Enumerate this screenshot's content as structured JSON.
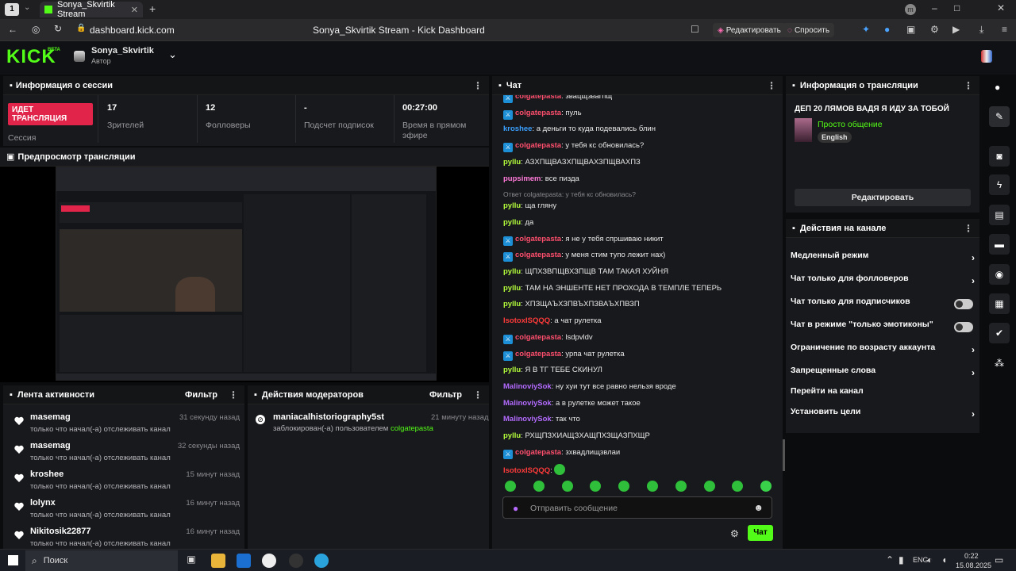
{
  "browser": {
    "tab_num": "1",
    "tab_title": "Sonya_Skvirtik Stream",
    "url": "dashboard.kick.com",
    "page_title": "Sonya_Skvirtik Stream - Kick Dashboard",
    "edit_label": "Редактировать",
    "ask_label": "Спросить",
    "avatar_letter": "m"
  },
  "header": {
    "logo": "KICK",
    "logo_sup": "BETA",
    "channel": "Sonya_Skvirtik",
    "role": "Автор"
  },
  "session": {
    "title": "Информация о сессии",
    "live_badge": "ИДЕТ ТРАНСЛЯЦИЯ",
    "live_label": "Сессия",
    "stats": [
      {
        "value": "17",
        "label": "Зрителей"
      },
      {
        "value": "12",
        "label": "Фолловеры"
      },
      {
        "value": "-",
        "label": "Подсчет подписок"
      },
      {
        "value": "00:27:00",
        "label": "Время в прямом эфире"
      }
    ]
  },
  "preview": {
    "title": "Предпросмотр трансляции"
  },
  "activity": {
    "title": "Лента активности",
    "filter": "Фильтр",
    "items": [
      {
        "name": "masemag",
        "time": "31 секунду назад",
        "desc": "только что начал(-а) отслеживать канал"
      },
      {
        "name": "masemag",
        "time": "32 секунды назад",
        "desc": "только что начал(-а) отслеживать канал"
      },
      {
        "name": "kroshee",
        "time": "15 минут назад",
        "desc": "только что начал(-а) отслеживать канал"
      },
      {
        "name": "lolynx",
        "time": "16 минут назад",
        "desc": "только что начал(-а) отслеживать канал"
      },
      {
        "name": "Nikitosik22877",
        "time": "16 минут назад",
        "desc": "только что начал(-а) отслеживать канал"
      }
    ]
  },
  "moderators": {
    "title": "Действия модераторов",
    "filter": "Фильтр",
    "item": {
      "name": "maniacalhistoriography5st",
      "time": "21 минуту назад",
      "desc": "заблокирован(-а) пользователем",
      "target": "colgatepasta"
    }
  },
  "chat": {
    "title": "Чат",
    "messages": [
      {
        "user": "colgatepasta",
        "color": "#ff4f6e",
        "badge": true,
        "text": "звацщзвагпщ"
      },
      {
        "user": "colgatepasta",
        "color": "#ff4f6e",
        "badge": true,
        "text": "пуль"
      },
      {
        "user": "kroshee",
        "color": "#3aa0ff",
        "badge": false,
        "text": "а деньги то куда подевались блин"
      },
      {
        "user": "colgatepasta",
        "color": "#ff4f6e",
        "badge": true,
        "text": "у тебя кс обновилась?"
      },
      {
        "user": "pyllu",
        "color": "#b6ff3c",
        "badge": false,
        "text": "АЗХПЩВАЗХПЩВАХЗПЩВАХПЗ"
      },
      {
        "user": "pupsimem",
        "color": "#ff7ad9",
        "badge": false,
        "text": "все пизда"
      },
      {
        "user": "pyllu",
        "color": "#b6ff3c",
        "badge": false,
        "text": "ща гляну",
        "reply": "Ответ colgatepasta: у тебя кс обновилась?"
      },
      {
        "user": "pyllu",
        "color": "#b6ff3c",
        "badge": false,
        "text": "да"
      },
      {
        "user": "colgatepasta",
        "color": "#ff4f6e",
        "badge": true,
        "text": "я не у тебя спршиваю никит"
      },
      {
        "user": "colgatepasta",
        "color": "#ff4f6e",
        "badge": true,
        "text": "у меня стим тупо лежит нах)"
      },
      {
        "user": "pyllu",
        "color": "#b6ff3c",
        "badge": false,
        "text": "ЩПХЗВПЩВХЗПЩВ ТАМ ТАКАЯ ХУЙНЯ"
      },
      {
        "user": "pyllu",
        "color": "#b6ff3c",
        "badge": false,
        "text": "ТАМ НА ЭНШЕНТЕ НЕТ ПРОХОДА В ТЕМПЛЕ ТЕПЕРЬ"
      },
      {
        "user": "pyllu",
        "color": "#b6ff3c",
        "badge": false,
        "text": "ХПЗЩАЪХЗПВЪХПЗВАЪХПВЗП"
      },
      {
        "user": "IsotoxISQQQ",
        "color": "#ff3b3b",
        "badge": false,
        "text": "а чат рулетка"
      },
      {
        "user": "colgatepasta",
        "color": "#ff4f6e",
        "badge": true,
        "text": "lsdpvldv"
      },
      {
        "user": "colgatepasta",
        "color": "#ff4f6e",
        "badge": true,
        "text": "урпа чат рулетка"
      },
      {
        "user": "pyllu",
        "color": "#b6ff3c",
        "badge": false,
        "text": "Я В ТГ ТЕБЕ СКИНУЛ"
      },
      {
        "user": "MalinoviySok",
        "color": "#b36bff",
        "badge": false,
        "text": "ну хуи тут все равно нельзя вроде"
      },
      {
        "user": "MalinoviySok",
        "color": "#b36bff",
        "badge": false,
        "text": "а в рулетке может такое"
      },
      {
        "user": "MalinoviySok",
        "color": "#b36bff",
        "badge": false,
        "text": "так что"
      },
      {
        "user": "pyllu",
        "color": "#b6ff3c",
        "badge": false,
        "text": "РХЩПЗХИАЩЗХАЩПХЗЩАЗПХЩР"
      },
      {
        "user": "colgatepasta",
        "color": "#ff4f6e",
        "badge": true,
        "text": "зхвадлищзвлаи"
      },
      {
        "user": "IsotoxISQQQ",
        "color": "#ff3b3b",
        "badge": false,
        "text": ""
      }
    ],
    "placeholder": "Отправить сообщение",
    "send": "Чат"
  },
  "stream_info": {
    "title": "Информация о трансляции",
    "stream_title": "ДЕП 20 ЛЯМОВ ВАДЯ Я ИДУ ЗА ТОБОЙ",
    "category": "Просто общение",
    "language": "English",
    "edit": "Редактировать"
  },
  "channel_actions": {
    "title": "Действия на канале",
    "items": [
      {
        "label": "Медленный режим",
        "control": "chevron"
      },
      {
        "label": "Чат только для фолловеров",
        "control": "chevron"
      },
      {
        "label": "Чат только для подписчиков",
        "control": "toggle"
      },
      {
        "label": "Чат в режиме \"только эмотиконы\"",
        "control": "toggle"
      },
      {
        "label": "Ограничение по возрасту аккаунта",
        "control": "chevron"
      },
      {
        "label": "Запрещенные слова",
        "control": "chevron"
      },
      {
        "label": "Перейти на канал",
        "control": "none"
      },
      {
        "label": "Установить цели",
        "control": "chevron"
      }
    ]
  },
  "taskbar": {
    "search": "Поиск",
    "lang": "ENG",
    "time": "0:22",
    "date": "15.08.2025"
  }
}
